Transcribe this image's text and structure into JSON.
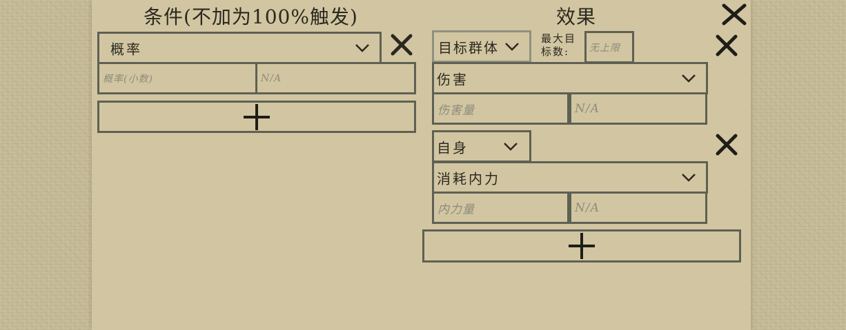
{
  "conditions": {
    "header": "条件(不加为100%触发)",
    "select_value": "概率",
    "input_placeholder_1": "概率(小数)",
    "input_placeholder_2": "N/A"
  },
  "effects": {
    "header": "效果",
    "effect1": {
      "target_value": "目标群体",
      "max_targets_label": "最大目\n标数:",
      "max_targets_placeholder": "无上限",
      "type_value": "伤害",
      "input_placeholder_1": "伤害量",
      "input_placeholder_2": "N/A"
    },
    "effect2": {
      "target_value": "自身",
      "type_value": "消耗内力",
      "input_placeholder_1": "内力量",
      "input_placeholder_2": "N/A"
    }
  },
  "colors": {
    "background": "#c6bb98",
    "panel": "#d1c6a1",
    "border": "#5e6054",
    "text": "#2b2820",
    "placeholder": "#8e8b7c"
  },
  "icons": {
    "close": "close-icon",
    "add": "plus-icon",
    "dropdown": "chevron-down-icon"
  }
}
